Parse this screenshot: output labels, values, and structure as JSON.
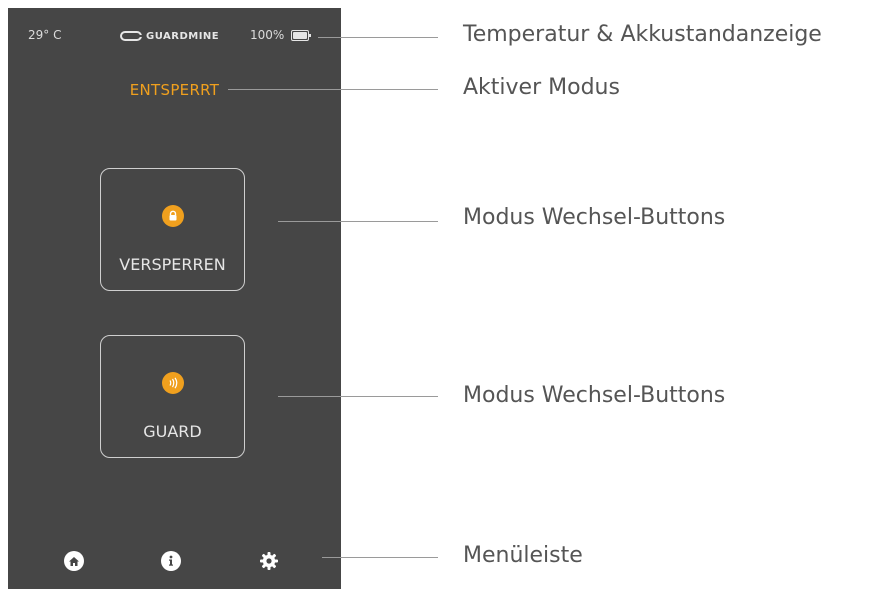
{
  "status": {
    "temperature": "29° C",
    "brand": "GUARDMINE",
    "battery": "100%"
  },
  "mode": {
    "active": "ENTSPERRT"
  },
  "buttons": [
    {
      "label": "VERSPERREN",
      "icon": "lock-icon"
    },
    {
      "label": "GUARD",
      "icon": "nfc-icon"
    }
  ],
  "menu": [
    {
      "icon": "home-icon"
    },
    {
      "icon": "info-icon"
    },
    {
      "icon": "gear-icon"
    }
  ],
  "callouts": [
    "Temperatur & Akkustandanzeige",
    "Aktiver Modus",
    "Modus Wechsel-Buttons",
    "Modus Wechsel-Buttons",
    "Menüleiste"
  ],
  "colors": {
    "accent": "#f0a01e",
    "phone_bg": "#464646"
  }
}
